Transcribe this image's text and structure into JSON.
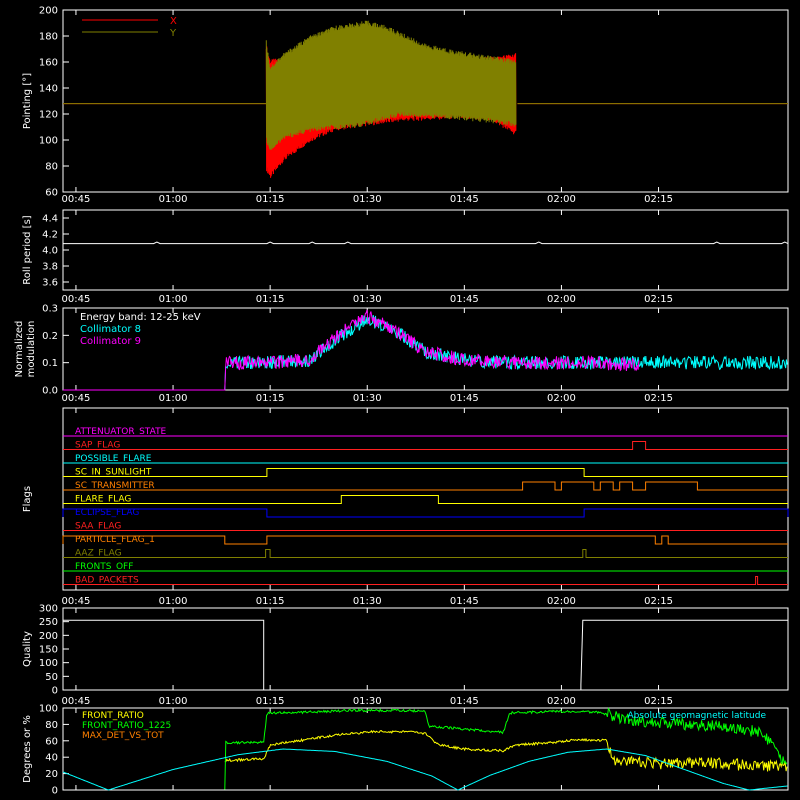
{
  "time_ticks": [
    "00:45",
    "01:00",
    "01:15",
    "01:30",
    "01:45",
    "02:00",
    "02:15"
  ],
  "colors": {
    "background": "#000000",
    "axis": "#ffffff",
    "x_series": "#ff0000",
    "y_series": "#808000",
    "cyan": "#00ffff",
    "magenta": "#ff00ff",
    "yellow": "#ffff00",
    "green": "#00ff00",
    "orange": "#ff8000",
    "blue": "#0000ff",
    "red": "#ff2020"
  },
  "chart_data": [
    {
      "id": "pointing",
      "type": "line",
      "ylabel": "Pointing [°]",
      "ylim": [
        60,
        200
      ],
      "yticks": [
        "60",
        "80",
        "100",
        "120",
        "140",
        "160",
        "180",
        "200"
      ],
      "legend": [
        "X",
        "Y"
      ],
      "series": [
        {
          "name": "X",
          "color": "#ff0000",
          "flat_before_after": 128,
          "upper_envelope": [
            [
              59.4,
              172
            ],
            [
              60,
              160
            ],
            [
              62,
              162
            ],
            [
              66,
              165
            ],
            [
              70,
              164
            ],
            [
              76,
              163
            ],
            [
              82,
              162
            ],
            [
              88,
              162
            ],
            [
              94,
              162
            ],
            [
              98,
              165
            ]
          ],
          "lower_envelope": [
            [
              59.4,
              78
            ],
            [
              60,
              72
            ],
            [
              62,
              85
            ],
            [
              66,
              100
            ],
            [
              70,
              109
            ],
            [
              74,
              112
            ],
            [
              80,
              116
            ],
            [
              88,
              118
            ],
            [
              94,
              117
            ],
            [
              98,
              105
            ]
          ]
        },
        {
          "name": "Y",
          "color": "#808000",
          "flat_before_after": 128,
          "upper_envelope": [
            [
              59.4,
              175
            ],
            [
              60,
              155
            ],
            [
              62,
              165
            ],
            [
              66,
              178
            ],
            [
              70,
              186
            ],
            [
              75,
              190
            ],
            [
              78,
              186
            ],
            [
              84,
              172
            ],
            [
              90,
              166
            ],
            [
              98,
              160
            ]
          ],
          "lower_envelope": [
            [
              59.4,
              100
            ],
            [
              60,
              93
            ],
            [
              62,
              102
            ],
            [
              66,
              108
            ],
            [
              70,
              110
            ],
            [
              74,
              112
            ],
            [
              80,
              120
            ],
            [
              88,
              118
            ],
            [
              94,
              115
            ],
            [
              98,
              112
            ]
          ]
        }
      ]
    },
    {
      "id": "roll",
      "type": "line",
      "ylabel": "Roll period [s]",
      "ylim": [
        3.5,
        4.5
      ],
      "yticks": [
        "3.6",
        "3.8",
        "4.0",
        "4.2",
        "4.4"
      ],
      "series": [
        {
          "name": "",
          "color": "#ffffff",
          "value": 4.08,
          "x_range": [
            28,
            140
          ]
        }
      ]
    },
    {
      "id": "modulation",
      "type": "line",
      "ylabel": [
        "Normalized",
        "modulation"
      ],
      "ylim": [
        0,
        0.3
      ],
      "yticks": [
        "0.0",
        "0.1",
        "0.2",
        "0.3"
      ],
      "legend": [
        "Energy band: 12-25 keV",
        "Collimator 8",
        "Collimator 9"
      ],
      "series": [
        {
          "name": "Collimator 8",
          "color": "#00ffff",
          "trend": [
            [
              53,
              0
            ],
            [
              53,
              0.1
            ],
            [
              60,
              0.1
            ],
            [
              66,
              0.11
            ],
            [
              71,
              0.2
            ],
            [
              75,
              0.26
            ],
            [
              79,
              0.22
            ],
            [
              84,
              0.14
            ],
            [
              90,
              0.11
            ],
            [
              98,
              0.1
            ],
            [
              105,
              0.1
            ],
            [
              110,
              0.1
            ],
            [
              120,
              0.1
            ],
            [
              130,
              0.1
            ],
            [
              140,
              0.1
            ]
          ]
        },
        {
          "name": "Collimator 9",
          "color": "#ff00ff",
          "trend": [
            [
              53,
              0
            ],
            [
              53,
              0.1
            ],
            [
              60,
              0.1
            ],
            [
              66,
              0.11
            ],
            [
              71,
              0.21
            ],
            [
              75,
              0.27
            ],
            [
              79,
              0.22
            ],
            [
              84,
              0.14
            ],
            [
              90,
              0.11
            ],
            [
              98,
              0.1
            ],
            [
              105,
              0.1
            ],
            [
              110,
              0.1
            ],
            [
              117,
              0.09
            ]
          ]
        }
      ]
    },
    {
      "id": "flags",
      "type": "line",
      "ylabel": "Flags",
      "flags": [
        {
          "name": "ATTENUATOR_STATE",
          "color": "#ff00ff",
          "high": []
        },
        {
          "name": "SAP_FLAG",
          "color": "#ff2020",
          "high": [
            [
              116,
              118
            ]
          ]
        },
        {
          "name": "POSSIBLE_FLARE",
          "color": "#00ffff",
          "high": []
        },
        {
          "name": "SC_IN_SUNLIGHT",
          "color": "#ffff00",
          "high": [
            [
              59.5,
              108.5
            ]
          ]
        },
        {
          "name": "SC_TRANSMITTER",
          "color": "#ff8000",
          "high": [
            [
              99,
              104
            ],
            [
              105,
              110
            ],
            [
              111,
              113
            ],
            [
              114,
              116
            ],
            [
              118,
              126
            ]
          ]
        },
        {
          "name": "FLARE_FLAG",
          "color": "#ffff00",
          "high": [
            [
              71,
              86
            ]
          ]
        },
        {
          "name": "ECLIPSE_FLAG",
          "color": "#0000ff",
          "high": [
            [
              28,
              59.5
            ],
            [
              108.5,
              140
            ]
          ]
        },
        {
          "name": "SAA_FLAG",
          "color": "#ff2020",
          "high": []
        },
        {
          "name": "PARTICLE_FLAG_1",
          "color": "#ff8000",
          "high": [
            [
              28,
              53
            ],
            [
              59.5,
              119.5
            ],
            [
              120.5,
              121.5
            ]
          ]
        },
        {
          "name": "AAZ_FLAG",
          "color": "#808000",
          "high": [
            [
              59.3,
              60
            ],
            [
              108.3,
              108.8
            ]
          ]
        },
        {
          "name": "FRONTS_OFF",
          "color": "#00ff00",
          "high": []
        },
        {
          "name": "BAD_PACKETS",
          "color": "#ff2020",
          "high": [
            [
              135,
              135.3
            ]
          ]
        }
      ]
    },
    {
      "id": "quality",
      "type": "line",
      "ylabel": "Quality",
      "ylim": [
        0,
        300
      ],
      "yticks": [
        "0",
        "50",
        "100",
        "150",
        "200",
        "250",
        "300"
      ],
      "series": [
        {
          "name": "",
          "color": "#ffffff",
          "points": [
            [
              28,
              255
            ],
            [
              59,
              255
            ],
            [
              59,
              0
            ],
            [
              108,
              0
            ],
            [
              108,
              20
            ],
            [
              108.3,
              255
            ],
            [
              140,
              255
            ]
          ]
        }
      ]
    },
    {
      "id": "ratios",
      "type": "line",
      "ylabel": "Degrees or %",
      "ylim": [
        0,
        100
      ],
      "yticks": [
        "0",
        "20",
        "40",
        "60",
        "80",
        "100"
      ],
      "legend": [
        "FRONT_RATIO",
        "FRONT_RATIO_1225",
        "MAX_DET_VS_TOT",
        "Absolute geomagnetic latitude"
      ],
      "series": [
        {
          "name": "FRONT_RATIO",
          "color": "#ffff00",
          "points": [
            [
              53,
              36
            ],
            [
              59,
              38
            ],
            [
              60,
              55
            ],
            [
              66,
              62
            ],
            [
              70,
              67
            ],
            [
              76,
              71
            ],
            [
              82,
              71
            ],
            [
              84,
              69
            ],
            [
              86,
              55
            ],
            [
              90,
              50
            ],
            [
              96,
              48
            ],
            [
              98,
              55
            ],
            [
              104,
              58
            ],
            [
              108,
              62
            ],
            [
              110,
              60
            ],
            [
              112,
              61
            ],
            [
              113,
              36
            ],
            [
              120,
              32
            ],
            [
              128,
              33
            ],
            [
              134,
              30
            ],
            [
              140,
              28
            ]
          ]
        },
        {
          "name": "FRONT_RATIO_1225",
          "color": "#00ff00",
          "points": [
            [
              53,
              0
            ],
            [
              53,
              58
            ],
            [
              59,
              58
            ],
            [
              59.5,
              94
            ],
            [
              66,
              95
            ],
            [
              72,
              97
            ],
            [
              80,
              97
            ],
            [
              84,
              96
            ],
            [
              84.5,
              78
            ],
            [
              92,
              73
            ],
            [
              96,
              70
            ],
            [
              97,
              94
            ],
            [
              104,
              96
            ],
            [
              110,
              95
            ],
            [
              112,
              93
            ],
            [
              114,
              88
            ],
            [
              118,
              82
            ],
            [
              124,
              80
            ],
            [
              130,
              78
            ],
            [
              136,
              70
            ],
            [
              140,
              30
            ]
          ]
        },
        {
          "name": "MAX_DET_VS_TOT",
          "color": "#ff8000",
          "points": []
        },
        {
          "name": "Absolute geomagnetic latitude",
          "color": "#00ffff",
          "points": [
            [
              28,
              22
            ],
            [
              35,
              0
            ],
            [
              45,
              25
            ],
            [
              55,
              43
            ],
            [
              62,
              50
            ],
            [
              70,
              47
            ],
            [
              78,
              35
            ],
            [
              85,
              17
            ],
            [
              89,
              0
            ],
            [
              94,
              18
            ],
            [
              100,
              35
            ],
            [
              106,
              46
            ],
            [
              112,
              50
            ],
            [
              118,
              42
            ],
            [
              124,
              25
            ],
            [
              130,
              8
            ],
            [
              134,
              0
            ],
            [
              140,
              5
            ]
          ]
        }
      ]
    }
  ]
}
